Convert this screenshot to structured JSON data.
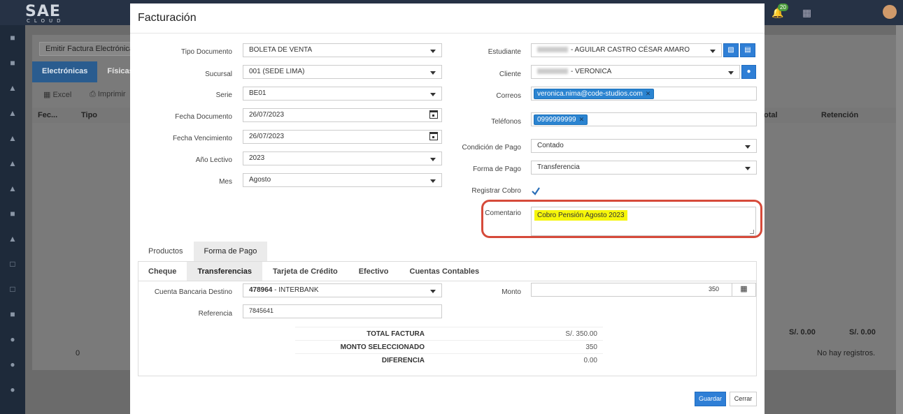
{
  "app": {
    "logo": "SAE",
    "logo_sub": "CLOUD",
    "badge": "20"
  },
  "background": {
    "emitir": "Emitir Factura Electrónica",
    "tabs": [
      "Electrónicas",
      "Físicas"
    ],
    "tool_excel": "Excel",
    "tool_print": "Imprimir",
    "col_fecha": "Fec...",
    "col_tipo": "Tipo",
    "col_total": "otal",
    "col_retencion": "Retención",
    "foot_total": "S/. 0.00",
    "foot_ret": "S/. 0.00",
    "pager_page": "0",
    "no_records": "No hay registros."
  },
  "modal": {
    "title": "Facturación",
    "left": {
      "tipo_doc": {
        "label": "Tipo Documento",
        "value": "BOLETA DE VENTA"
      },
      "sucursal": {
        "label": "Sucursal",
        "value": "001 (SEDE LIMA)"
      },
      "serie": {
        "label": "Serie",
        "value": "BE01"
      },
      "fecha_doc": {
        "label": "Fecha Documento",
        "value": "26/07/2023"
      },
      "fecha_venc": {
        "label": "Fecha Vencimiento",
        "value": "26/07/2023"
      },
      "anio": {
        "label": "Año Lectivo",
        "value": "2023"
      },
      "mes": {
        "label": "Mes",
        "value": "Agosto"
      }
    },
    "right": {
      "estudiante": {
        "label": "Estudiante",
        "value": "- AGUILAR CASTRO CÉSAR AMARO"
      },
      "cliente": {
        "label": "Cliente",
        "value": "- VERONICA"
      },
      "correos": {
        "label": "Correos",
        "tag": "veronica.nima@code-studios.com"
      },
      "telefonos": {
        "label": "Teléfonos",
        "tag": "0999999999"
      },
      "condicion": {
        "label": "Condición de Pago",
        "value": "Contado"
      },
      "forma": {
        "label": "Forma de Pago",
        "value": "Transferencia"
      },
      "registrar": {
        "label": "Registrar Cobro",
        "checked": true
      },
      "comentario": {
        "label": "Comentario",
        "value": "Cobro Pensión Agosto 2023"
      }
    },
    "tabs": [
      "Productos",
      "Forma de Pago"
    ],
    "subtabs": [
      "Cheque",
      "Transferencias",
      "Tarjeta de Crédito",
      "Efectivo",
      "Cuentas Contables"
    ],
    "transfer": {
      "cuenta_label": "Cuenta Bancaria Destino",
      "cuenta_num": "478964",
      "cuenta_bank": "- INTERBANK",
      "referencia_label": "Referencia",
      "referencia": "7845641",
      "monto_label": "Monto",
      "monto": "350"
    },
    "summary": [
      {
        "label": "TOTAL FACTURA",
        "value": "S/. 350.00"
      },
      {
        "label": "MONTO SELECCIONADO",
        "value": "350"
      },
      {
        "label": "DIFERENCIA",
        "value": "0.00"
      }
    ],
    "buttons": {
      "save": "Guardar",
      "close": "Cerrar"
    }
  },
  "colors": {
    "accent": "#2f7fd6",
    "highlight": "#f6f60a",
    "ring": "#d64a3a"
  }
}
